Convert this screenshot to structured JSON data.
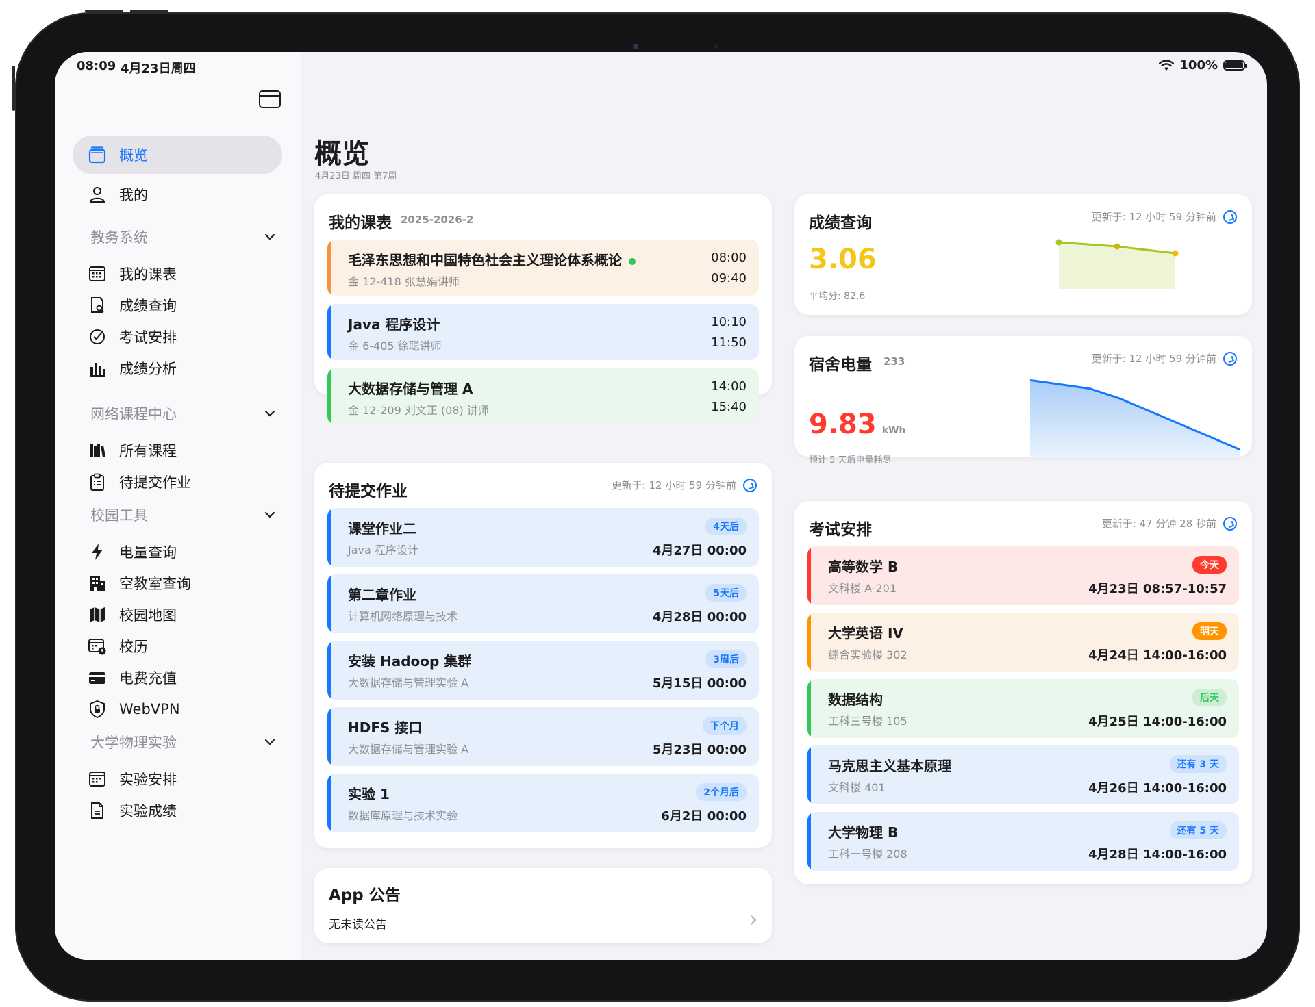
{
  "status_bar": {
    "time": "08:09",
    "date": "4月23日周四",
    "battery": "100%"
  },
  "sidebar": {
    "items": [
      {
        "label": "概览",
        "icon": "overview-icon",
        "active": true
      },
      {
        "label": "我的",
        "icon": "person-icon"
      }
    ],
    "sections": [
      {
        "title": "教务系统",
        "items": [
          {
            "label": "我的课表",
            "icon": "calendar-grid-icon"
          },
          {
            "label": "成绩查询",
            "icon": "doc-search-icon"
          },
          {
            "label": "考试安排",
            "icon": "check-pen-icon"
          },
          {
            "label": "成绩分析",
            "icon": "bar-chart-icon"
          }
        ]
      },
      {
        "title": "网络课程中心",
        "items": [
          {
            "label": "所有课程",
            "icon": "books-icon"
          },
          {
            "label": "待提交作业",
            "icon": "clipboard-list-icon"
          }
        ]
      },
      {
        "title": "校园工具",
        "items": [
          {
            "label": "电量查询",
            "icon": "bolt-icon"
          },
          {
            "label": "空教室查询",
            "icon": "building-icon"
          },
          {
            "label": "校园地图",
            "icon": "map-icon"
          },
          {
            "label": "校历",
            "icon": "calendar-clock-icon"
          },
          {
            "label": "电费充值",
            "icon": "credit-card-icon"
          },
          {
            "label": "WebVPN",
            "icon": "shield-lock-icon"
          }
        ]
      },
      {
        "title": "大学物理实验",
        "items": [
          {
            "label": "实验安排",
            "icon": "calendar-grid-icon"
          },
          {
            "label": "实验成绩",
            "icon": "document-icon"
          }
        ]
      }
    ]
  },
  "main": {
    "title": "概览",
    "subtitle": "4月23日 周四 第7周",
    "schedule": {
      "title": "我的课表",
      "term": "2025-2026-2",
      "courses": [
        {
          "name": "毛泽东思想和中国特色社会主义理论体系概论",
          "location": "金 12-418  张慧娟讲师",
          "start": "08:00",
          "end": "09:40",
          "color": "#f5933f",
          "bg": "#fdf1e6",
          "live": true
        },
        {
          "name": "Java 程序设计",
          "location": "金 6-405  徐聪讲师",
          "start": "10:10",
          "end": "11:50",
          "color": "#1677ff",
          "bg": "#e6f0fd"
        },
        {
          "name": "大数据存储与管理 A",
          "location": "金 12-209  刘文正 (08) 讲师",
          "start": "14:00",
          "end": "15:40",
          "color": "#34c759",
          "bg": "#e9f7ec"
        }
      ]
    },
    "homework": {
      "title": "待提交作业",
      "updated": "更新于:  12 小时 59 分钟前",
      "items": [
        {
          "name": "课堂作业二",
          "course": "Java 程序设计",
          "badge": "4天后",
          "due": "4月27日 00:00"
        },
        {
          "name": "第二章作业",
          "course": "计算机网络原理与技术",
          "badge": "5天后",
          "due": "4月28日 00:00"
        },
        {
          "name": "安装 Hadoop 集群",
          "course": "大数据存储与管理实验 A",
          "badge": "3周后",
          "due": "5月15日 00:00"
        },
        {
          "name": "HDFS 接口",
          "course": "大数据存储与管理实验 A",
          "badge": "下个月",
          "due": "5月23日 00:00"
        },
        {
          "name": "实验 1",
          "course": "数据库原理与技术实验",
          "badge": "2个月后",
          "due": "6月2日 00:00"
        }
      ]
    },
    "announcement": {
      "title": "App 公告",
      "text": "无未读公告"
    },
    "grades": {
      "title": "成绩查询",
      "updated": "更新于:  12 小时 59 分钟前",
      "gpa": "3.06",
      "average": "平均分: 82.6",
      "trend": [
        3.14,
        3.11,
        3.06
      ]
    },
    "electricity": {
      "title": "宿舍电量",
      "room": "233",
      "updated": "更新于:  12 小时 59 分钟前",
      "value": "9.83",
      "unit": "kWh",
      "note": "预计 5 天后电量耗尽",
      "trend": [
        55,
        52,
        49,
        42,
        33,
        24,
        15,
        6
      ]
    },
    "exams": {
      "title": "考试安排",
      "updated": "更新于:  47 分钟 28 秒前",
      "items": [
        {
          "name": "高等数学 B",
          "place": "文科楼 A-201",
          "badge": "今天",
          "time": "4月23日 08:57-10:57",
          "color": "#ff3b30",
          "bg": "#fde8e7",
          "badge_bg": "#ff3b30",
          "badge_fg": "#ffffff"
        },
        {
          "name": "大学英语 IV",
          "place": "综合实验楼 302",
          "badge": "明天",
          "time": "4月24日 14:00-16:00",
          "color": "#ff9500",
          "bg": "#fdf1e6",
          "badge_bg": "#ff9500",
          "badge_fg": "#ffffff"
        },
        {
          "name": "数据结构",
          "place": "工科三号楼 105",
          "badge": "后天",
          "time": "4月25日 14:00-16:00",
          "color": "#34c759",
          "bg": "#e9f7ec",
          "badge_bg": "#cdeed5",
          "badge_fg": "#34c759"
        },
        {
          "name": "马克思主义基本原理",
          "place": "文科楼 401",
          "badge": "还有 3 天",
          "time": "4月26日 14:00-16:00",
          "color": "#1677ff",
          "bg": "#e6f0fd",
          "badge_bg": "#cfe2fb",
          "badge_fg": "#1677ff"
        },
        {
          "name": "大学物理 B",
          "place": "工科一号楼 208",
          "badge": "还有 5 天",
          "time": "4月28日 14:00-16:00",
          "color": "#1677ff",
          "bg": "#e6f0fd",
          "badge_bg": "#cfe2fb",
          "badge_fg": "#1677ff"
        }
      ]
    }
  },
  "colors": {
    "accent": "#1677ff",
    "gpa": "#f5c518",
    "electricity": "#ff3b30",
    "grade_line": "#a4c81e",
    "elec_line": "#1677ff"
  }
}
